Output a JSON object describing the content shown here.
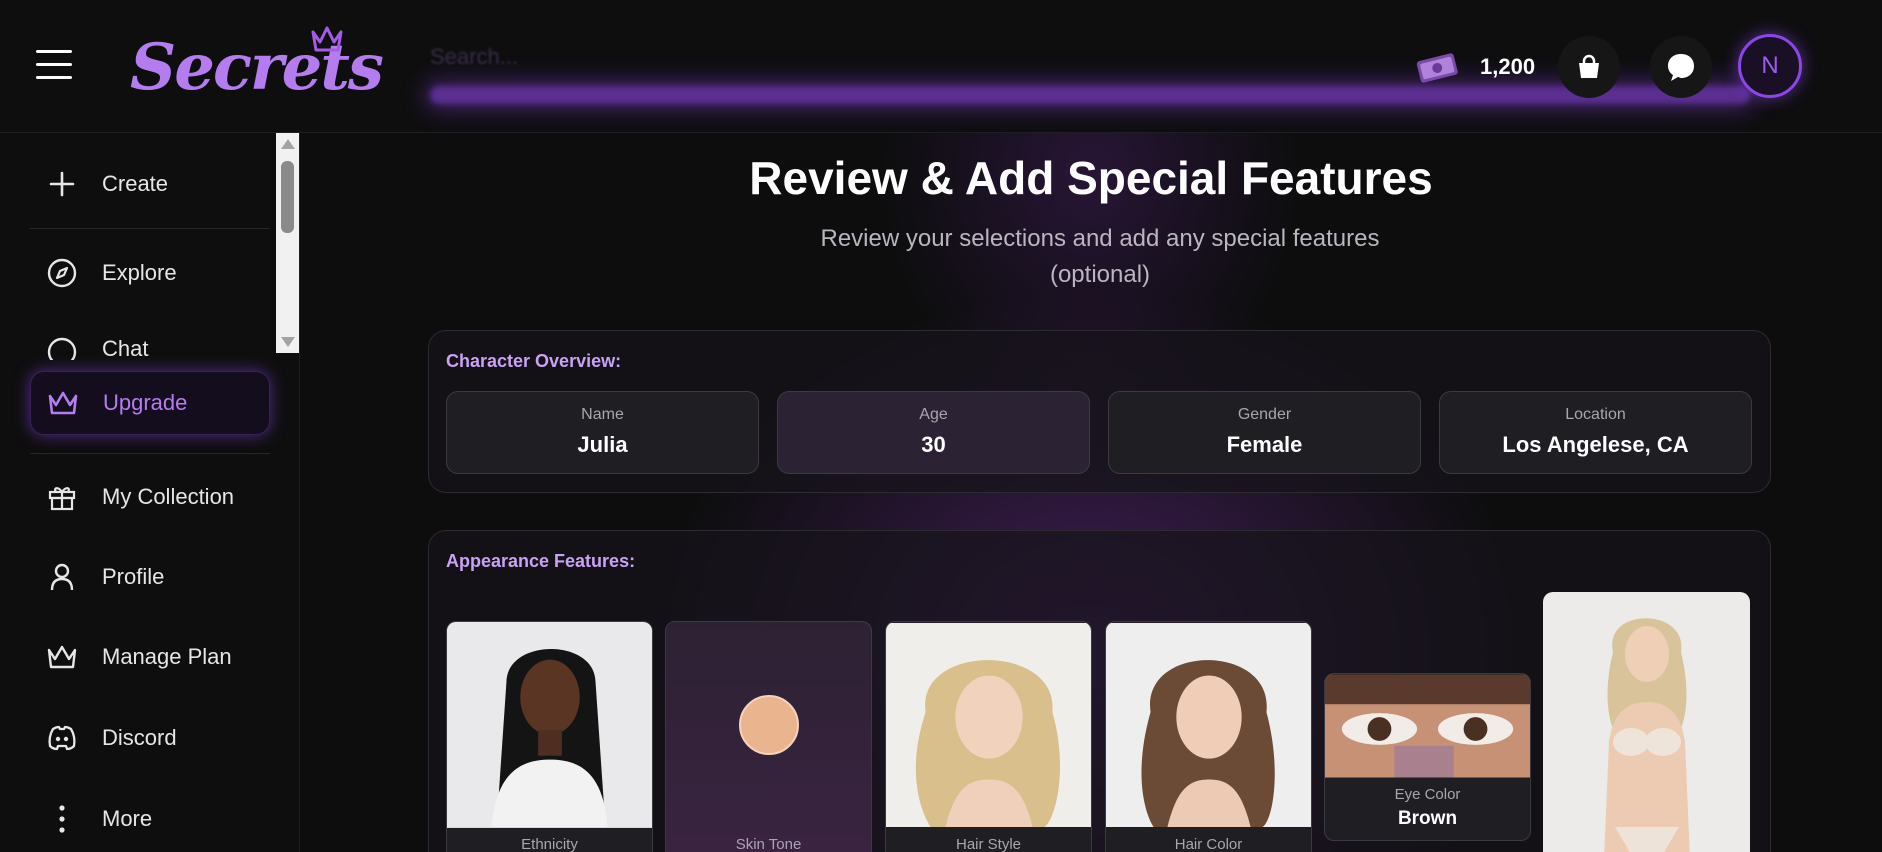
{
  "header": {
    "logo_text": "Secrets",
    "search_placeholder": "Search...",
    "coins": "1,200",
    "avatar_initial": "N",
    "accent_color": "#8c45e6"
  },
  "sidebar": {
    "items": [
      {
        "label": "Create",
        "icon": "plus-icon"
      },
      {
        "label": "Explore",
        "icon": "compass-icon"
      },
      {
        "label": "Chat",
        "icon": "chat-icon"
      },
      {
        "label": "Upgrade",
        "icon": "crown-icon"
      },
      {
        "label": "My Collection",
        "icon": "gift-icon"
      },
      {
        "label": "Profile",
        "icon": "user-icon"
      },
      {
        "label": "Manage Plan",
        "icon": "crown-outline-icon"
      },
      {
        "label": "Discord",
        "icon": "discord-icon"
      },
      {
        "label": "More",
        "icon": "more-vertical-icon"
      }
    ]
  },
  "main": {
    "title": "Review & Add Special Features",
    "subtitle": "Review your selections and add any special features (optional)",
    "overview": {
      "title": "Character Overview:",
      "fields": [
        {
          "label": "Name",
          "value": "Julia"
        },
        {
          "label": "Age",
          "value": "30"
        },
        {
          "label": "Gender",
          "value": "Female"
        },
        {
          "label": "Location",
          "value": "Los Angelese, CA"
        }
      ]
    },
    "appearance": {
      "title": "Appearance Features:",
      "features": [
        {
          "label": "Ethnicity",
          "value": ""
        },
        {
          "label": "Skin Tone",
          "value": "",
          "swatch_color": "#eab48f"
        },
        {
          "label": "Hair Style",
          "value": ""
        },
        {
          "label": "Hair Color",
          "value": ""
        },
        {
          "label": "Eye Color",
          "value": "Brown"
        },
        {
          "label": "",
          "value": ""
        }
      ]
    }
  }
}
